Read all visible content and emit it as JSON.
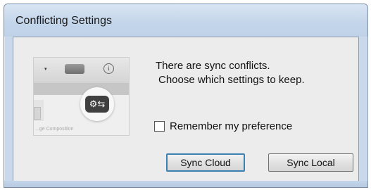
{
  "window": {
    "title": "Conflicting Settings"
  },
  "illustration": {
    "dropdown_glyph": "▾",
    "info_glyph": "i",
    "sync_glyph": "⚙⇆",
    "caption": "...ge Composition"
  },
  "message": {
    "line1": "There are sync conflicts.",
    "line2": "Choose which settings to keep."
  },
  "checkbox": {
    "label": "Remember my preference",
    "checked": false
  },
  "buttons": {
    "sync_cloud": "Sync Cloud",
    "sync_local": "Sync Local"
  },
  "colors": {
    "titlebar": "#c9d9eb",
    "client": "#ececec",
    "focus_border": "#3c7fb1"
  }
}
